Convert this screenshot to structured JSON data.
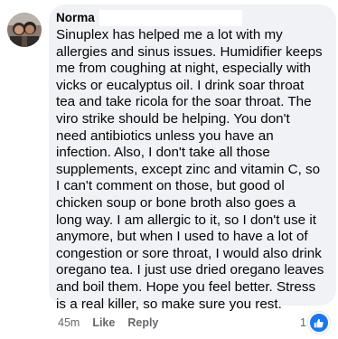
{
  "comment": {
    "author": "Norma",
    "text": "Sinuplex has helped me a lot with my\nallergies and sinus issues. Humidifier keeps\nme from coughing at night, especially with\nvicks or eucalyptus oil. I drink soar throat\ntea and take ricola for the soar throat. The\nviro strike should be helping. You don't\nneed antibiotics unless you have an\ninfection. Also, I don't take all those\nsupplements, except zinc and vitamin C, so\nI can't comment on those, but good ol\nchicken soup or bone broth also goes a\nlong way. I am allergic to it, so I don't use it\nanymore, but when I used to have a lot of\ncongestion or sore throat, I would also drink\noregano tea. I just use dried oregano leaves\nand boil them. Hope you feel better. Stress\nis a real killer, so make sure you rest.",
    "timestamp": "45m",
    "like_label": "Like",
    "reply_label": "Reply",
    "reaction_count": "1",
    "reaction_icon": "like-thumb-icon"
  },
  "colors": {
    "bubble_bg": "#f0f2f5",
    "text": "#050505",
    "secondary": "#65676b",
    "reaction_blue": "#1877f2"
  }
}
